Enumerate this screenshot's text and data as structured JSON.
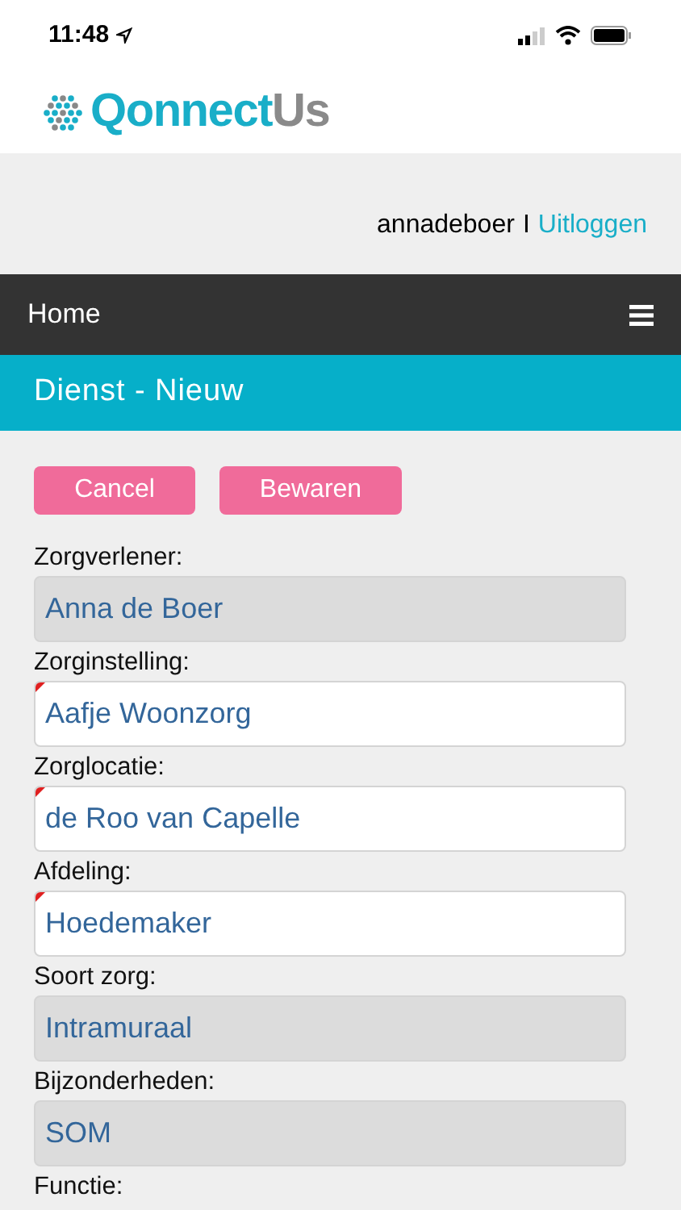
{
  "status_bar": {
    "time": "11:48"
  },
  "header": {
    "logo_primary": "Qonnect",
    "logo_secondary": "Us"
  },
  "user_bar": {
    "username": "annadeboer",
    "separator": "I",
    "logout": "Uitloggen"
  },
  "nav": {
    "home": "Home"
  },
  "page_title": "Dienst - Nieuw",
  "buttons": [
    "Cancel",
    "Bewaren"
  ],
  "fields": [
    {
      "label": "Zorgverlener:",
      "value": "Anna de Boer",
      "disabled": true,
      "required": false
    },
    {
      "label": "Zorginstelling:",
      "value": "Aafje Woonzorg",
      "disabled": false,
      "required": true
    },
    {
      "label": "Zorglocatie:",
      "value": "de Roo van Capelle",
      "disabled": false,
      "required": true
    },
    {
      "label": "Afdeling:",
      "value": "Hoedemaker",
      "disabled": false,
      "required": true
    },
    {
      "label": "Soort zorg:",
      "value": "Intramuraal",
      "disabled": true,
      "required": false
    },
    {
      "label": "Bijzonderheden:",
      "value": "SOM",
      "disabled": true,
      "required": false
    },
    {
      "label": "Functie:"
    }
  ]
}
